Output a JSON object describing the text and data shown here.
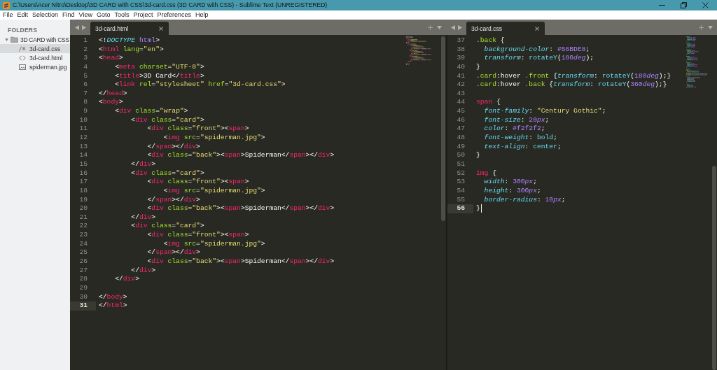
{
  "window": {
    "title": "C:\\Users\\Acer Nitro\\Desktop\\3D CARD with CSS\\3d-card.css (3D CARD with CSS) - Sublime Text (UNREGISTERED)"
  },
  "menu_bar": [
    "File",
    "Edit",
    "Selection",
    "Find",
    "View",
    "Goto",
    "Tools",
    "Project",
    "Preferences",
    "Help"
  ],
  "sidebar": {
    "heading": "FOLDERS",
    "folders": [
      {
        "name": "3D CARD with CSS",
        "expanded": true,
        "selected": false,
        "children": [
          {
            "name": "3d-card.css",
            "kind": "css",
            "selected": true
          },
          {
            "name": "3d-card.html",
            "kind": "html",
            "selected": false
          },
          {
            "name": "spiderman.jpg",
            "kind": "image",
            "selected": false
          }
        ]
      }
    ]
  },
  "panes": [
    {
      "focused": false,
      "tabs": [
        {
          "label": "3d-card.html",
          "selected": true
        }
      ],
      "lines": [
        {
          "number": "1",
          "current": false,
          "tokens": [
            {
              "kind": "plain",
              "text": "<!"
            },
            {
              "kind": "doctype",
              "text": "DOCTYPE"
            },
            {
              "kind": "constant",
              "text": " html"
            },
            {
              "kind": "plain",
              "text": ">"
            }
          ]
        },
        {
          "number": "2",
          "current": false,
          "tokens": [
            {
              "kind": "plain",
              "text": "<"
            },
            {
              "kind": "tag",
              "text": "html"
            },
            {
              "kind": "attribute",
              "text": " lang"
            },
            {
              "kind": "plain",
              "text": "="
            },
            {
              "kind": "string",
              "text": "\"en\""
            },
            {
              "kind": "plain",
              "text": ">"
            }
          ]
        },
        {
          "number": "3",
          "current": false,
          "tokens": [
            {
              "kind": "plain",
              "text": "<"
            },
            {
              "kind": "tag",
              "text": "head"
            },
            {
              "kind": "plain",
              "text": ">"
            }
          ]
        },
        {
          "number": "4",
          "current": false,
          "tokens": [
            {
              "kind": "plain",
              "text": "    <"
            },
            {
              "kind": "tag",
              "text": "meta"
            },
            {
              "kind": "attribute",
              "text": " charset"
            },
            {
              "kind": "plain",
              "text": "="
            },
            {
              "kind": "string",
              "text": "\"UTF-8\""
            },
            {
              "kind": "plain",
              "text": ">"
            }
          ]
        },
        {
          "number": "5",
          "current": false,
          "tokens": [
            {
              "kind": "plain",
              "text": "    <"
            },
            {
              "kind": "tag",
              "text": "title"
            },
            {
              "kind": "plain",
              "text": ">3D Card</"
            },
            {
              "kind": "tag",
              "text": "title"
            },
            {
              "kind": "plain",
              "text": ">"
            }
          ]
        },
        {
          "number": "6",
          "current": false,
          "tokens": [
            {
              "kind": "plain",
              "text": "    <"
            },
            {
              "kind": "tag",
              "text": "link"
            },
            {
              "kind": "attribute",
              "text": " rel"
            },
            {
              "kind": "plain",
              "text": "="
            },
            {
              "kind": "string",
              "text": "\"stylesheet\""
            },
            {
              "kind": "attribute",
              "text": " href"
            },
            {
              "kind": "plain",
              "text": "="
            },
            {
              "kind": "string",
              "text": "\"3d-card.css\""
            },
            {
              "kind": "plain",
              "text": ">"
            }
          ]
        },
        {
          "number": "7",
          "current": false,
          "tokens": [
            {
              "kind": "plain",
              "text": "</"
            },
            {
              "kind": "tag",
              "text": "head"
            },
            {
              "kind": "plain",
              "text": ">"
            }
          ]
        },
        {
          "number": "8",
          "current": false,
          "tokens": [
            {
              "kind": "plain",
              "text": "<"
            },
            {
              "kind": "tag",
              "text": "body"
            },
            {
              "kind": "plain",
              "text": ">"
            }
          ]
        },
        {
          "number": "9",
          "current": false,
          "tokens": [
            {
              "kind": "plain",
              "text": "    <"
            },
            {
              "kind": "tag",
              "text": "div"
            },
            {
              "kind": "attribute",
              "text": " class"
            },
            {
              "kind": "plain",
              "text": "="
            },
            {
              "kind": "string",
              "text": "\"wrap\""
            },
            {
              "kind": "plain",
              "text": ">"
            }
          ]
        },
        {
          "number": "10",
          "current": false,
          "tokens": [
            {
              "kind": "plain",
              "text": "        <"
            },
            {
              "kind": "tag",
              "text": "div"
            },
            {
              "kind": "attribute",
              "text": " class"
            },
            {
              "kind": "plain",
              "text": "="
            },
            {
              "kind": "string",
              "text": "\"card\""
            },
            {
              "kind": "plain",
              "text": ">"
            }
          ]
        },
        {
          "number": "11",
          "current": false,
          "tokens": [
            {
              "kind": "plain",
              "text": "            <"
            },
            {
              "kind": "tag",
              "text": "div"
            },
            {
              "kind": "attribute",
              "text": " class"
            },
            {
              "kind": "plain",
              "text": "="
            },
            {
              "kind": "string",
              "text": "\"front\""
            },
            {
              "kind": "plain",
              "text": "><"
            },
            {
              "kind": "tag",
              "text": "span"
            },
            {
              "kind": "plain",
              "text": ">"
            }
          ]
        },
        {
          "number": "12",
          "current": false,
          "tokens": [
            {
              "kind": "plain",
              "text": "                <"
            },
            {
              "kind": "tag",
              "text": "img"
            },
            {
              "kind": "attribute",
              "text": " src"
            },
            {
              "kind": "plain",
              "text": "="
            },
            {
              "kind": "string",
              "text": "\"spiderman.jpg\""
            },
            {
              "kind": "plain",
              "text": ">"
            }
          ]
        },
        {
          "number": "13",
          "current": false,
          "tokens": [
            {
              "kind": "plain",
              "text": "            </"
            },
            {
              "kind": "tag",
              "text": "span"
            },
            {
              "kind": "plain",
              "text": "></"
            },
            {
              "kind": "tag",
              "text": "div"
            },
            {
              "kind": "plain",
              "text": ">"
            }
          ]
        },
        {
          "number": "14",
          "current": false,
          "tokens": [
            {
              "kind": "plain",
              "text": "            <"
            },
            {
              "kind": "tag",
              "text": "div"
            },
            {
              "kind": "attribute",
              "text": " class"
            },
            {
              "kind": "plain",
              "text": "="
            },
            {
              "kind": "string",
              "text": "\"back\""
            },
            {
              "kind": "plain",
              "text": "><"
            },
            {
              "kind": "tag",
              "text": "span"
            },
            {
              "kind": "plain",
              "text": ">Spiderman</"
            },
            {
              "kind": "tag",
              "text": "span"
            },
            {
              "kind": "plain",
              "text": "></"
            },
            {
              "kind": "tag",
              "text": "div"
            },
            {
              "kind": "plain",
              "text": ">"
            }
          ]
        },
        {
          "number": "15",
          "current": false,
          "tokens": [
            {
              "kind": "plain",
              "text": "        </"
            },
            {
              "kind": "tag",
              "text": "div"
            },
            {
              "kind": "plain",
              "text": ">"
            }
          ]
        },
        {
          "number": "16",
          "current": false,
          "tokens": [
            {
              "kind": "plain",
              "text": "        <"
            },
            {
              "kind": "tag",
              "text": "div"
            },
            {
              "kind": "attribute",
              "text": " class"
            },
            {
              "kind": "plain",
              "text": "="
            },
            {
              "kind": "string",
              "text": "\"card\""
            },
            {
              "kind": "plain",
              "text": ">"
            }
          ]
        },
        {
          "number": "17",
          "current": false,
          "tokens": [
            {
              "kind": "plain",
              "text": "            <"
            },
            {
              "kind": "tag",
              "text": "div"
            },
            {
              "kind": "attribute",
              "text": " class"
            },
            {
              "kind": "plain",
              "text": "="
            },
            {
              "kind": "string",
              "text": "\"front\""
            },
            {
              "kind": "plain",
              "text": "><"
            },
            {
              "kind": "tag",
              "text": "span"
            },
            {
              "kind": "plain",
              "text": ">"
            }
          ]
        },
        {
          "number": "18",
          "current": false,
          "tokens": [
            {
              "kind": "plain",
              "text": "                <"
            },
            {
              "kind": "tag",
              "text": "img"
            },
            {
              "kind": "attribute",
              "text": " src"
            },
            {
              "kind": "plain",
              "text": "="
            },
            {
              "kind": "string",
              "text": "\"spiderman.jpg\""
            },
            {
              "kind": "plain",
              "text": ">"
            }
          ]
        },
        {
          "number": "19",
          "current": false,
          "tokens": [
            {
              "kind": "plain",
              "text": "            </"
            },
            {
              "kind": "tag",
              "text": "span"
            },
            {
              "kind": "plain",
              "text": "></"
            },
            {
              "kind": "tag",
              "text": "div"
            },
            {
              "kind": "plain",
              "text": ">"
            }
          ]
        },
        {
          "number": "20",
          "current": false,
          "tokens": [
            {
              "kind": "plain",
              "text": "            <"
            },
            {
              "kind": "tag",
              "text": "div"
            },
            {
              "kind": "attribute",
              "text": " class"
            },
            {
              "kind": "plain",
              "text": "="
            },
            {
              "kind": "string",
              "text": "\"back\""
            },
            {
              "kind": "plain",
              "text": "><"
            },
            {
              "kind": "tag",
              "text": "span"
            },
            {
              "kind": "plain",
              "text": ">Spiderman</"
            },
            {
              "kind": "tag",
              "text": "span"
            },
            {
              "kind": "plain",
              "text": "></"
            },
            {
              "kind": "tag",
              "text": "div"
            },
            {
              "kind": "plain",
              "text": ">"
            }
          ]
        },
        {
          "number": "21",
          "current": false,
          "tokens": [
            {
              "kind": "plain",
              "text": "        </"
            },
            {
              "kind": "tag",
              "text": "div"
            },
            {
              "kind": "plain",
              "text": ">"
            }
          ]
        },
        {
          "number": "22",
          "current": false,
          "tokens": [
            {
              "kind": "plain",
              "text": "        <"
            },
            {
              "kind": "tag",
              "text": "div"
            },
            {
              "kind": "attribute",
              "text": " class"
            },
            {
              "kind": "plain",
              "text": "="
            },
            {
              "kind": "string",
              "text": "\"card\""
            },
            {
              "kind": "plain",
              "text": ">"
            }
          ]
        },
        {
          "number": "23",
          "current": false,
          "tokens": [
            {
              "kind": "plain",
              "text": "            <"
            },
            {
              "kind": "tag",
              "text": "div"
            },
            {
              "kind": "attribute",
              "text": " class"
            },
            {
              "kind": "plain",
              "text": "="
            },
            {
              "kind": "string",
              "text": "\"front\""
            },
            {
              "kind": "plain",
              "text": "><"
            },
            {
              "kind": "tag",
              "text": "span"
            },
            {
              "kind": "plain",
              "text": ">"
            }
          ]
        },
        {
          "number": "24",
          "current": false,
          "tokens": [
            {
              "kind": "plain",
              "text": "                <"
            },
            {
              "kind": "tag",
              "text": "img"
            },
            {
              "kind": "attribute",
              "text": " src"
            },
            {
              "kind": "plain",
              "text": "="
            },
            {
              "kind": "string",
              "text": "\"spiderman.jpg\""
            },
            {
              "kind": "plain",
              "text": ">"
            }
          ]
        },
        {
          "number": "25",
          "current": false,
          "tokens": [
            {
              "kind": "plain",
              "text": "            </"
            },
            {
              "kind": "tag",
              "text": "span"
            },
            {
              "kind": "plain",
              "text": "></"
            },
            {
              "kind": "tag",
              "text": "div"
            },
            {
              "kind": "plain",
              "text": ">"
            }
          ]
        },
        {
          "number": "26",
          "current": false,
          "tokens": [
            {
              "kind": "plain",
              "text": "            <"
            },
            {
              "kind": "tag",
              "text": "div"
            },
            {
              "kind": "attribute",
              "text": " class"
            },
            {
              "kind": "plain",
              "text": "="
            },
            {
              "kind": "string",
              "text": "\"back\""
            },
            {
              "kind": "plain",
              "text": "><"
            },
            {
              "kind": "tag",
              "text": "span"
            },
            {
              "kind": "plain",
              "text": ">Spiderman</"
            },
            {
              "kind": "tag",
              "text": "span"
            },
            {
              "kind": "plain",
              "text": "></"
            },
            {
              "kind": "tag",
              "text": "div"
            },
            {
              "kind": "plain",
              "text": ">"
            }
          ]
        },
        {
          "number": "27",
          "current": false,
          "tokens": [
            {
              "kind": "plain",
              "text": "        </"
            },
            {
              "kind": "tag",
              "text": "div"
            },
            {
              "kind": "plain",
              "text": ">"
            }
          ]
        },
        {
          "number": "28",
          "current": false,
          "tokens": [
            {
              "kind": "plain",
              "text": "    </"
            },
            {
              "kind": "tag",
              "text": "div"
            },
            {
              "kind": "plain",
              "text": ">"
            }
          ]
        },
        {
          "number": "29",
          "current": false
        },
        {
          "number": "30",
          "current": false,
          "tokens": [
            {
              "kind": "plain",
              "text": "</"
            },
            {
              "kind": "tag",
              "text": "body"
            },
            {
              "kind": "plain",
              "text": ">"
            }
          ]
        },
        {
          "number": "31",
          "current": true,
          "tokens": [
            {
              "kind": "plain",
              "text": "</"
            },
            {
              "kind": "tag",
              "text": "html"
            },
            {
              "kind": "plain",
              "text": ">"
            }
          ]
        }
      ]
    },
    {
      "focused": true,
      "tabs": [
        {
          "label": "3d-card.css",
          "selected": true
        }
      ],
      "lines": [
        {
          "number": "37",
          "current": false,
          "tokens": [
            {
              "kind": "class",
              "text": ".back"
            },
            {
              "kind": "plain",
              "text": " {"
            }
          ]
        },
        {
          "number": "38",
          "current": false,
          "tokens": [
            {
              "kind": "property",
              "text": "  background-color"
            },
            {
              "kind": "plain",
              "text": ": "
            },
            {
              "kind": "constant",
              "text": "#56BDE8"
            },
            {
              "kind": "plain",
              "text": ";"
            }
          ]
        },
        {
          "number": "39",
          "current": false,
          "tokens": [
            {
              "kind": "property",
              "text": "  transform"
            },
            {
              "kind": "plain",
              "text": ": "
            },
            {
              "kind": "function",
              "text": "rotateY"
            },
            {
              "kind": "plain",
              "text": "("
            },
            {
              "kind": "constant",
              "text": "180"
            },
            {
              "kind": "unit",
              "text": "deg"
            },
            {
              "kind": "plain",
              "text": ");"
            }
          ]
        },
        {
          "number": "40",
          "current": false,
          "tokens": [
            {
              "kind": "plain",
              "text": "}"
            }
          ]
        },
        {
          "number": "41",
          "current": false,
          "tokens": [
            {
              "kind": "class",
              "text": ".card"
            },
            {
              "kind": "plain",
              "text": ":hover "
            },
            {
              "kind": "class",
              "text": ".front"
            },
            {
              "kind": "plain",
              "text": " {"
            },
            {
              "kind": "property",
              "text": "transform"
            },
            {
              "kind": "plain",
              "text": ": "
            },
            {
              "kind": "function",
              "text": "rotateY"
            },
            {
              "kind": "plain",
              "text": "("
            },
            {
              "kind": "constant",
              "text": "180"
            },
            {
              "kind": "unit",
              "text": "deg"
            },
            {
              "kind": "plain",
              "text": ");}"
            }
          ]
        },
        {
          "number": "42",
          "current": false,
          "tokens": [
            {
              "kind": "class",
              "text": ".card"
            },
            {
              "kind": "plain",
              "text": ":hover "
            },
            {
              "kind": "class",
              "text": ".back"
            },
            {
              "kind": "plain",
              "text": " {"
            },
            {
              "kind": "property",
              "text": "transform"
            },
            {
              "kind": "plain",
              "text": ": "
            },
            {
              "kind": "function",
              "text": "rotateY"
            },
            {
              "kind": "plain",
              "text": "("
            },
            {
              "kind": "constant",
              "text": "360"
            },
            {
              "kind": "unit",
              "text": "deg"
            },
            {
              "kind": "plain",
              "text": ");}"
            }
          ]
        },
        {
          "number": "43",
          "current": false
        },
        {
          "number": "44",
          "current": false,
          "tokens": [
            {
              "kind": "tag",
              "text": "span"
            },
            {
              "kind": "plain",
              "text": " {"
            }
          ]
        },
        {
          "number": "45",
          "current": false,
          "tokens": [
            {
              "kind": "property",
              "text": "  font-family"
            },
            {
              "kind": "plain",
              "text": ": "
            },
            {
              "kind": "string",
              "text": "\"Century Gothic\""
            },
            {
              "kind": "plain",
              "text": ";"
            }
          ]
        },
        {
          "number": "46",
          "current": false,
          "tokens": [
            {
              "kind": "property",
              "text": "  font-size"
            },
            {
              "kind": "plain",
              "text": ": "
            },
            {
              "kind": "constant",
              "text": "20"
            },
            {
              "kind": "unit",
              "text": "px"
            },
            {
              "kind": "plain",
              "text": ";"
            }
          ]
        },
        {
          "number": "47",
          "current": false,
          "tokens": [
            {
              "kind": "property",
              "text": "  color"
            },
            {
              "kind": "plain",
              "text": ": "
            },
            {
              "kind": "constant",
              "text": "#f2f2f2"
            },
            {
              "kind": "plain",
              "text": ";"
            }
          ]
        },
        {
          "number": "48",
          "current": false,
          "tokens": [
            {
              "kind": "property",
              "text": "  font-weight"
            },
            {
              "kind": "plain",
              "text": ": "
            },
            {
              "kind": "keyword",
              "text": "bold"
            },
            {
              "kind": "plain",
              "text": ";"
            }
          ]
        },
        {
          "number": "49",
          "current": false,
          "tokens": [
            {
              "kind": "property",
              "text": "  text-align"
            },
            {
              "kind": "plain",
              "text": ": "
            },
            {
              "kind": "keyword",
              "text": "center"
            },
            {
              "kind": "plain",
              "text": ";"
            }
          ]
        },
        {
          "number": "50",
          "current": false,
          "tokens": [
            {
              "kind": "plain",
              "text": "}"
            }
          ]
        },
        {
          "number": "51",
          "current": false
        },
        {
          "number": "52",
          "current": false,
          "tokens": [
            {
              "kind": "tag",
              "text": "img"
            },
            {
              "kind": "plain",
              "text": " {"
            }
          ]
        },
        {
          "number": "53",
          "current": false,
          "tokens": [
            {
              "kind": "property",
              "text": "  width"
            },
            {
              "kind": "plain",
              "text": ": "
            },
            {
              "kind": "constant",
              "text": "300"
            },
            {
              "kind": "unit",
              "text": "px"
            },
            {
              "kind": "plain",
              "text": ";"
            }
          ]
        },
        {
          "number": "54",
          "current": false,
          "tokens": [
            {
              "kind": "property",
              "text": "  height"
            },
            {
              "kind": "plain",
              "text": ": "
            },
            {
              "kind": "constant",
              "text": "300"
            },
            {
              "kind": "unit",
              "text": "px"
            },
            {
              "kind": "plain",
              "text": ";"
            }
          ]
        },
        {
          "number": "55",
          "current": false,
          "tokens": [
            {
              "kind": "property",
              "text": "  border-radius"
            },
            {
              "kind": "plain",
              "text": ": "
            },
            {
              "kind": "constant",
              "text": "10"
            },
            {
              "kind": "unit",
              "text": "px"
            },
            {
              "kind": "plain",
              "text": ";"
            }
          ]
        },
        {
          "number": "56",
          "current": true,
          "tokens": [
            {
              "kind": "plain",
              "text": "}"
            }
          ]
        }
      ]
    }
  ]
}
